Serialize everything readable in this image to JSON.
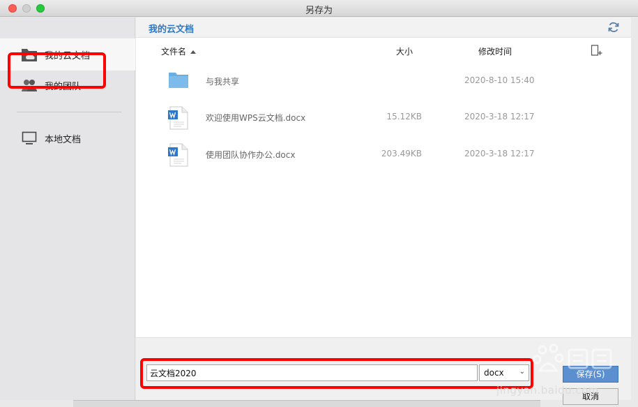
{
  "window": {
    "title": "另存为"
  },
  "sidebar": {
    "items": [
      {
        "label": "我的云文档"
      },
      {
        "label": "我的团队"
      },
      {
        "label": "本地文档"
      }
    ]
  },
  "breadcrumb": {
    "current": "我的云文档"
  },
  "columns": {
    "name": "文件名",
    "size": "大小",
    "modified": "修改时间"
  },
  "files": [
    {
      "name": "与我共享",
      "size": "",
      "modified": "2020-8-10 15:40",
      "icon": "folder-icon"
    },
    {
      "name": "欢迎使用WPS云文档.docx",
      "size": "15.12KB",
      "modified": "2020-3-18 12:17",
      "icon": "word-doc-icon"
    },
    {
      "name": "使用团队协作办公.docx",
      "size": "203.49KB",
      "modified": "2020-3-18 12:17",
      "icon": "word-doc-icon"
    }
  ],
  "save": {
    "filename_value": "云文档2020",
    "extension": "docx",
    "save_label": "保存(S)",
    "cancel_label": "取消"
  },
  "watermark": {
    "text": "jingyan.baidu.com"
  },
  "colors": {
    "accent": "#2b79c7",
    "highlight": "#ff0000",
    "save_button": "#5b8fd0"
  }
}
